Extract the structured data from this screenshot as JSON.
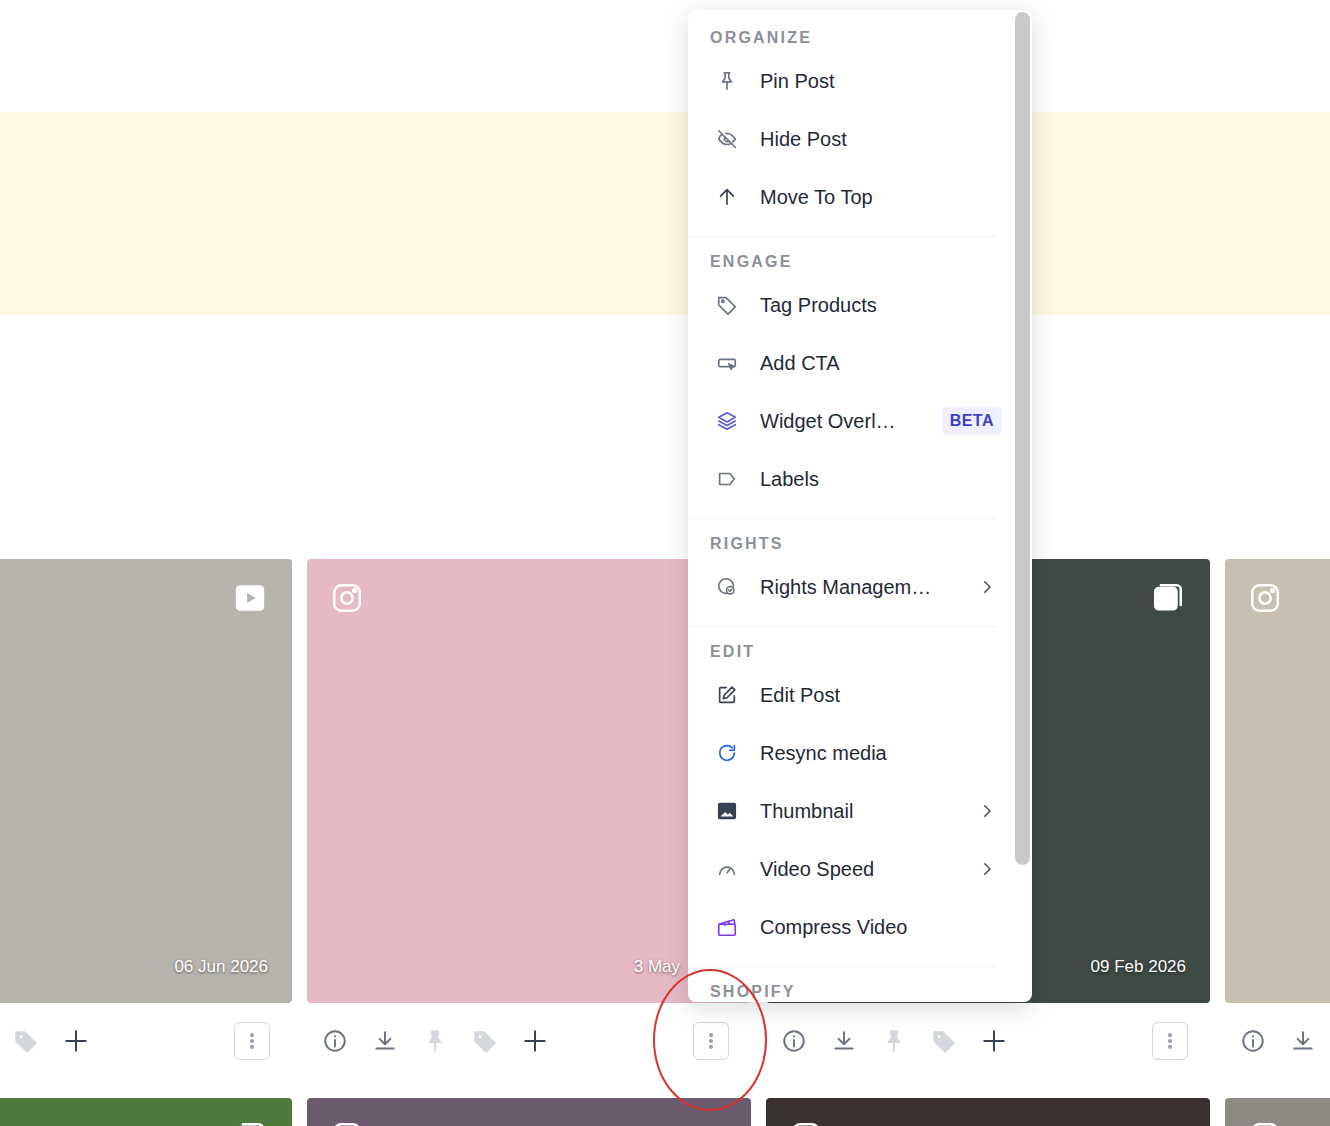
{
  "menu": {
    "sections": [
      {
        "title": "ORGANIZE",
        "items": [
          {
            "label": "Pin Post",
            "has_submenu": false
          },
          {
            "label": "Hide Post",
            "has_submenu": false
          },
          {
            "label": "Move To Top",
            "has_submenu": false
          }
        ]
      },
      {
        "title": "ENGAGE",
        "items": [
          {
            "label": "Tag Products",
            "has_submenu": false
          },
          {
            "label": "Add CTA",
            "has_submenu": false
          },
          {
            "label": "Widget Overl…",
            "badge": "BETA",
            "has_submenu": false
          },
          {
            "label": "Labels",
            "has_submenu": false
          }
        ]
      },
      {
        "title": "RIGHTS",
        "items": [
          {
            "label": "Rights Managem…",
            "has_submenu": true
          }
        ]
      },
      {
        "title": "EDIT",
        "items": [
          {
            "label": "Edit Post",
            "has_submenu": false
          },
          {
            "label": "Resync media",
            "has_submenu": false
          },
          {
            "label": "Thumbnail",
            "has_submenu": true
          },
          {
            "label": "Video Speed",
            "has_submenu": true
          },
          {
            "label": "Compress Video",
            "has_submenu": false
          }
        ]
      },
      {
        "title": "SHOPIFY",
        "items": []
      }
    ],
    "scroll": {
      "level": 0.86
    }
  },
  "post_rows": [
    [
      {
        "date": "06 Jun 2026",
        "actions": [
          {
            "kind": "tag",
            "disabled": true
          },
          {
            "kind": "add",
            "disabled": false
          },
          {
            "kind": "more",
            "disabled": false,
            "circled": false
          }
        ]
      },
      {
        "date": "3 May",
        "actions": [
          {
            "kind": "info",
            "disabled": false
          },
          {
            "kind": "download",
            "disabled": false
          },
          {
            "kind": "pin",
            "disabled": true
          },
          {
            "kind": "tag",
            "disabled": true
          },
          {
            "kind": "add",
            "disabled": false
          },
          {
            "kind": "more",
            "disabled": false,
            "circled": true
          }
        ]
      },
      {
        "date": "09 Feb 2026",
        "actions": [
          {
            "kind": "info",
            "disabled": false
          },
          {
            "kind": "download",
            "disabled": false
          },
          {
            "kind": "pin",
            "disabled": true
          },
          {
            "kind": "tag",
            "disabled": true
          },
          {
            "kind": "add",
            "disabled": false
          },
          {
            "kind": "more",
            "disabled": false,
            "circled": false
          }
        ]
      },
      {
        "actions": [
          {
            "kind": "info",
            "disabled": false
          },
          {
            "kind": "download",
            "disabled": false
          }
        ]
      }
    ],
    [
      {},
      {},
      {},
      {}
    ]
  ]
}
